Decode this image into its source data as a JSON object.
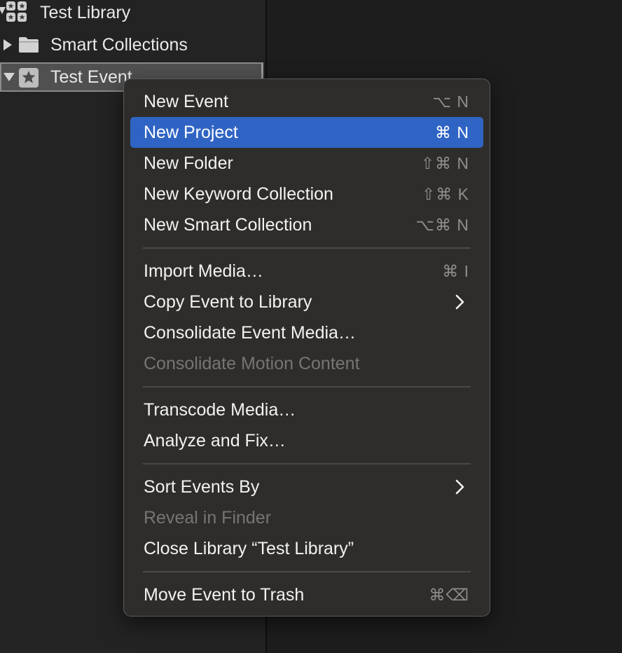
{
  "sidebar": {
    "library": {
      "label": "Test Library",
      "expanded": true,
      "icon": "library-grid-icon"
    },
    "smart_collections": {
      "label": "Smart Collections",
      "expanded": false,
      "icon": "folder-icon"
    },
    "event": {
      "label": "Test Event",
      "expanded": true,
      "selected": true,
      "icon": "event-star-icon"
    }
  },
  "menu": {
    "groups": [
      [
        {
          "label": "New Event",
          "shortcut": "⌥ N",
          "enabled": true
        },
        {
          "label": "New Project",
          "shortcut": "⌘ N",
          "enabled": true,
          "highlighted": true
        },
        {
          "label": "New Folder",
          "shortcut": "⇧⌘ N",
          "enabled": true
        },
        {
          "label": "New Keyword Collection",
          "shortcut": "⇧⌘ K",
          "enabled": true
        },
        {
          "label": "New Smart Collection",
          "shortcut": "⌥⌘ N",
          "enabled": true
        }
      ],
      [
        {
          "label": "Import Media…",
          "shortcut": "⌘ I",
          "enabled": true
        },
        {
          "label": "Copy Event to Library",
          "submenu": true,
          "enabled": true
        },
        {
          "label": "Consolidate Event Media…",
          "enabled": true
        },
        {
          "label": "Consolidate Motion Content",
          "enabled": false
        }
      ],
      [
        {
          "label": "Transcode Media…",
          "enabled": true
        },
        {
          "label": "Analyze and Fix…",
          "enabled": true
        }
      ],
      [
        {
          "label": "Sort Events By",
          "submenu": true,
          "enabled": true
        },
        {
          "label": "Reveal in Finder",
          "enabled": false
        },
        {
          "label": "Close Library “Test Library”",
          "enabled": true
        }
      ],
      [
        {
          "label": "Move Event to Trash",
          "shortcut": "⌘⌫",
          "enabled": true
        }
      ]
    ]
  },
  "colors": {
    "highlight": "#2f64c4",
    "menu_bg": "#2f2d2b",
    "sidebar_bg": "#232323",
    "selected_row": "#505050"
  }
}
